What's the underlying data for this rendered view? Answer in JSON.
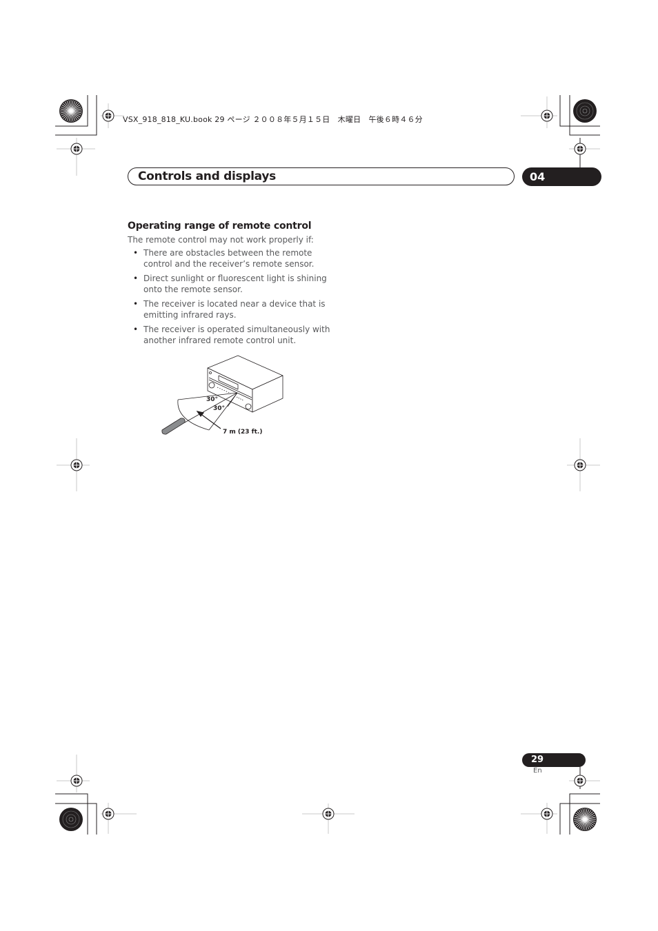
{
  "print_header": {
    "text": "VSX_918_818_KU.book  29 ページ  ２００８年５月１５日　木曜日　午後６時４６分"
  },
  "section": {
    "title": "Controls and displays",
    "chapter_number": "04"
  },
  "content": {
    "heading": "Operating range of remote control",
    "intro": "The remote control may not work properly if:",
    "bullets": [
      "There are obstacles between the remote control and the receiver’s remote sensor.",
      "Direct sunlight or fluorescent light is shining onto the remote sensor.",
      "The receiver is located near a device that is emitting infrared rays.",
      "The receiver is operated simultaneously with another infrared remote control unit."
    ],
    "bullet_glyph": "•"
  },
  "figure": {
    "name": "remote-control-operating-range-diagram",
    "angle_upper_label": "30°",
    "angle_lower_label": "30°",
    "distance_label": "7 m (23 ft.)"
  },
  "footer": {
    "page_number": "29",
    "language": "En"
  },
  "print_marks": {
    "registration_mark_icon": "crosshair-circle",
    "color_wheel_icon": "starburst-circle"
  }
}
